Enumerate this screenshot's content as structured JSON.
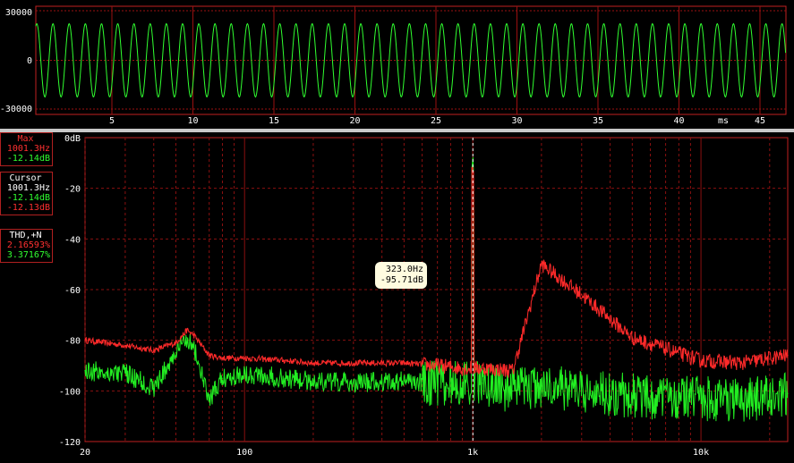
{
  "waveform": {
    "y_labels": [
      "30000",
      "0",
      "-30000"
    ],
    "x_labels": [
      "5",
      "10",
      "15",
      "20",
      "25",
      "30",
      "35",
      "40",
      "45"
    ],
    "x_unit": "ms",
    "colors": {
      "trace": "#30ff30",
      "grid": "#9a1010",
      "frame": "#c02020"
    }
  },
  "max_panel": {
    "title": "Max",
    "freq": "1001.3Hz",
    "level": "-12.14dB"
  },
  "cursor_panel": {
    "title": "Cursor",
    "freq": "1001.3Hz",
    "level_green": "-12.14dB",
    "level_red": "-12.13dB"
  },
  "thd_panel": {
    "title": "THD,+N",
    "value_red": "2.16593%",
    "value_green": "3.37167%"
  },
  "tooltip": {
    "freq": "323.0Hz",
    "level": "-95.71dB"
  },
  "chart_data": {
    "type": "line",
    "x_scale": "log",
    "xlim": [
      20,
      24000
    ],
    "ylim": [
      -120,
      0
    ],
    "x_ticks": [
      "20",
      "100",
      "1k",
      "10k"
    ],
    "y_ticks": [
      "0dB",
      "-20",
      "-40",
      "-60",
      "-80",
      "-100",
      "-120"
    ],
    "cursor_x": 1001.3,
    "series": [
      {
        "color": "#ff2a2a",
        "x": [
          20,
          30,
          40,
          50,
          56,
          60,
          70,
          80,
          100,
          150,
          200,
          300,
          500,
          700,
          900,
          1001.3,
          1100,
          1500,
          2000,
          3000,
          5000,
          10000,
          15000,
          24000
        ],
        "y": [
          -80,
          -82,
          -84,
          -81,
          -76,
          -78,
          -86,
          -87,
          -87,
          -88,
          -89,
          -89,
          -89,
          -90,
          -91,
          -12.14,
          -91,
          -92,
          -50,
          -62,
          -79,
          -88,
          -89,
          -86
        ]
      },
      {
        "color": "#22ee22",
        "x": [
          20,
          30,
          40,
          50,
          56,
          60,
          70,
          80,
          100,
          150,
          200,
          300,
          500,
          700,
          900,
          1001.3,
          1100,
          1500,
          2000,
          3000,
          5000,
          10000,
          15000,
          24000
        ],
        "y": [
          -92,
          -93,
          -99,
          -85,
          -79,
          -83,
          -104,
          -95,
          -93,
          -95,
          -96,
          -97,
          -96,
          -97,
          -97,
          -12.14,
          -97,
          -100,
          -98,
          -100,
          -102,
          -103,
          -104,
          -101
        ]
      }
    ]
  }
}
